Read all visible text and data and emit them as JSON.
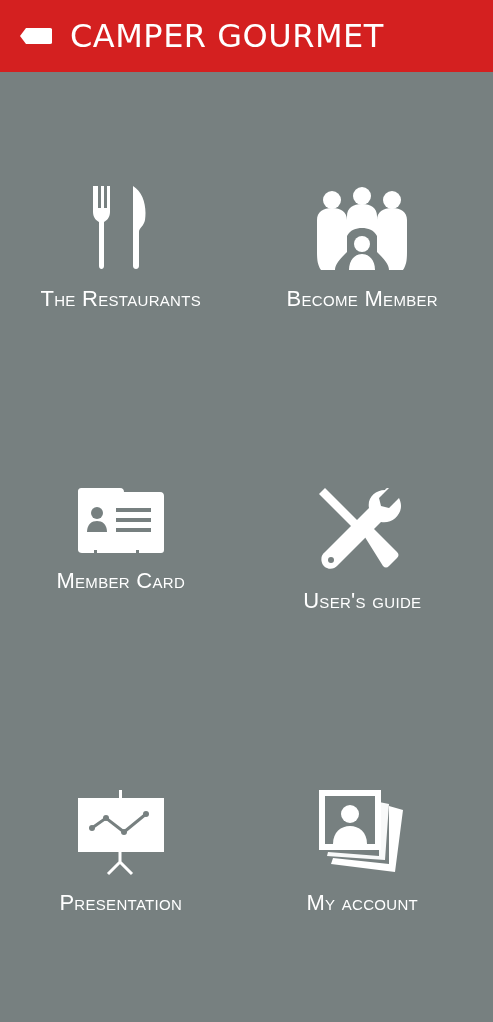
{
  "header": {
    "title": "CAMPER GOURMET"
  },
  "menu": [
    {
      "kind": "restaurants",
      "label": "The Restaurants"
    },
    {
      "kind": "members",
      "label": "Become Member"
    },
    {
      "kind": "card",
      "label": "Member Card"
    },
    {
      "kind": "tools",
      "label": "User's guide"
    },
    {
      "kind": "presentation",
      "label": "Presentation"
    },
    {
      "kind": "photos",
      "label": "My account"
    }
  ]
}
